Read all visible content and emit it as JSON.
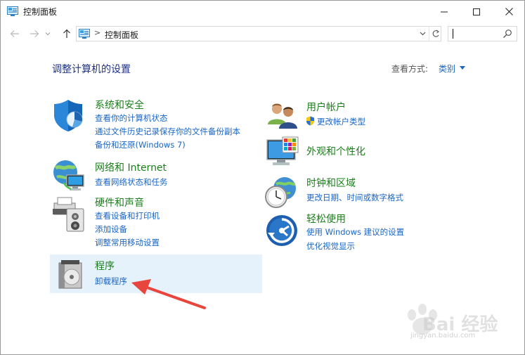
{
  "window": {
    "title": "控制面板"
  },
  "address": {
    "path": "控制面板",
    "separator": ">"
  },
  "search": {
    "placeholder": ""
  },
  "header": {
    "heading": "调整计算机的设置",
    "view_by_label": "查看方式:",
    "view_by_value": "类别"
  },
  "categories_left": [
    {
      "title": "系统和安全",
      "icon": "shield-icon",
      "links": [
        "查看你的计算机状态",
        "通过文件历史记录保存你的文件备份副本",
        "备份和还原(Windows 7)"
      ]
    },
    {
      "title": "网络和 Internet",
      "icon": "network-globe-icon",
      "links": [
        "查看网络状态和任务"
      ]
    },
    {
      "title": "硬件和声音",
      "icon": "printer-speaker-icon",
      "links": [
        "查看设备和打印机",
        "添加设备",
        "调整常用移动设置"
      ]
    },
    {
      "title": "程序",
      "icon": "programs-disc-icon",
      "links": [
        "卸载程序"
      ]
    }
  ],
  "categories_right": [
    {
      "title": "用户帐户",
      "icon": "users-icon",
      "links": [
        "更改帐户类型"
      ]
    },
    {
      "title": "外观和个性化",
      "icon": "monitor-palette-icon",
      "links": []
    },
    {
      "title": "时钟和区域",
      "icon": "clock-globe-icon",
      "links": [
        "更改日期、时间或数字格式"
      ]
    },
    {
      "title": "轻松使用",
      "icon": "ease-of-access-icon",
      "links": [
        "使用 Windows 建议的设置",
        "优化视觉显示"
      ]
    }
  ],
  "watermark": {
    "text": "Bai 经验",
    "sub": "jingyan.baidu.com"
  },
  "colors": {
    "category_title": "#1a7f1a",
    "link": "#1a66c6",
    "heading": "#1e3287",
    "highlight": "#e5f1fb",
    "arrow": "#e8453c"
  }
}
